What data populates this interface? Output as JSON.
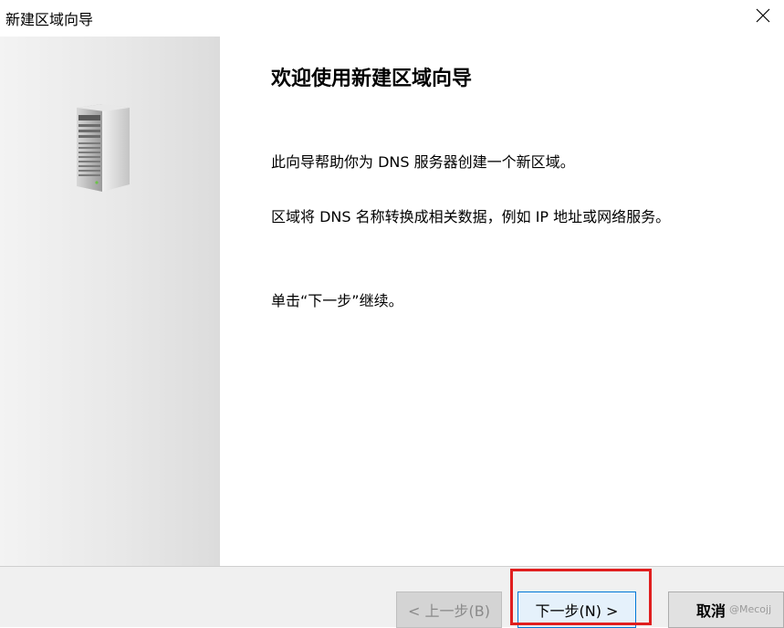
{
  "window": {
    "title": "新建区域向导",
    "close_icon": "close-icon"
  },
  "side_panel": {
    "image_icon": "server-tower-icon"
  },
  "content": {
    "heading": "欢迎使用新建区域向导",
    "paragraph_1": "此向导帮助你为 DNS 服务器创建一个新区域。",
    "paragraph_2": "区域将 DNS 名称转换成相关数据，例如 IP 地址或网络服务。",
    "paragraph_3": "单击“下一步”继续。"
  },
  "footer": {
    "back_label": "< 上一步(B)",
    "next_label": "下一步(N) >",
    "cancel_label": "取消"
  },
  "annotation": {
    "highlight_color": "#e01e1e"
  },
  "watermark": "@Mecojj"
}
